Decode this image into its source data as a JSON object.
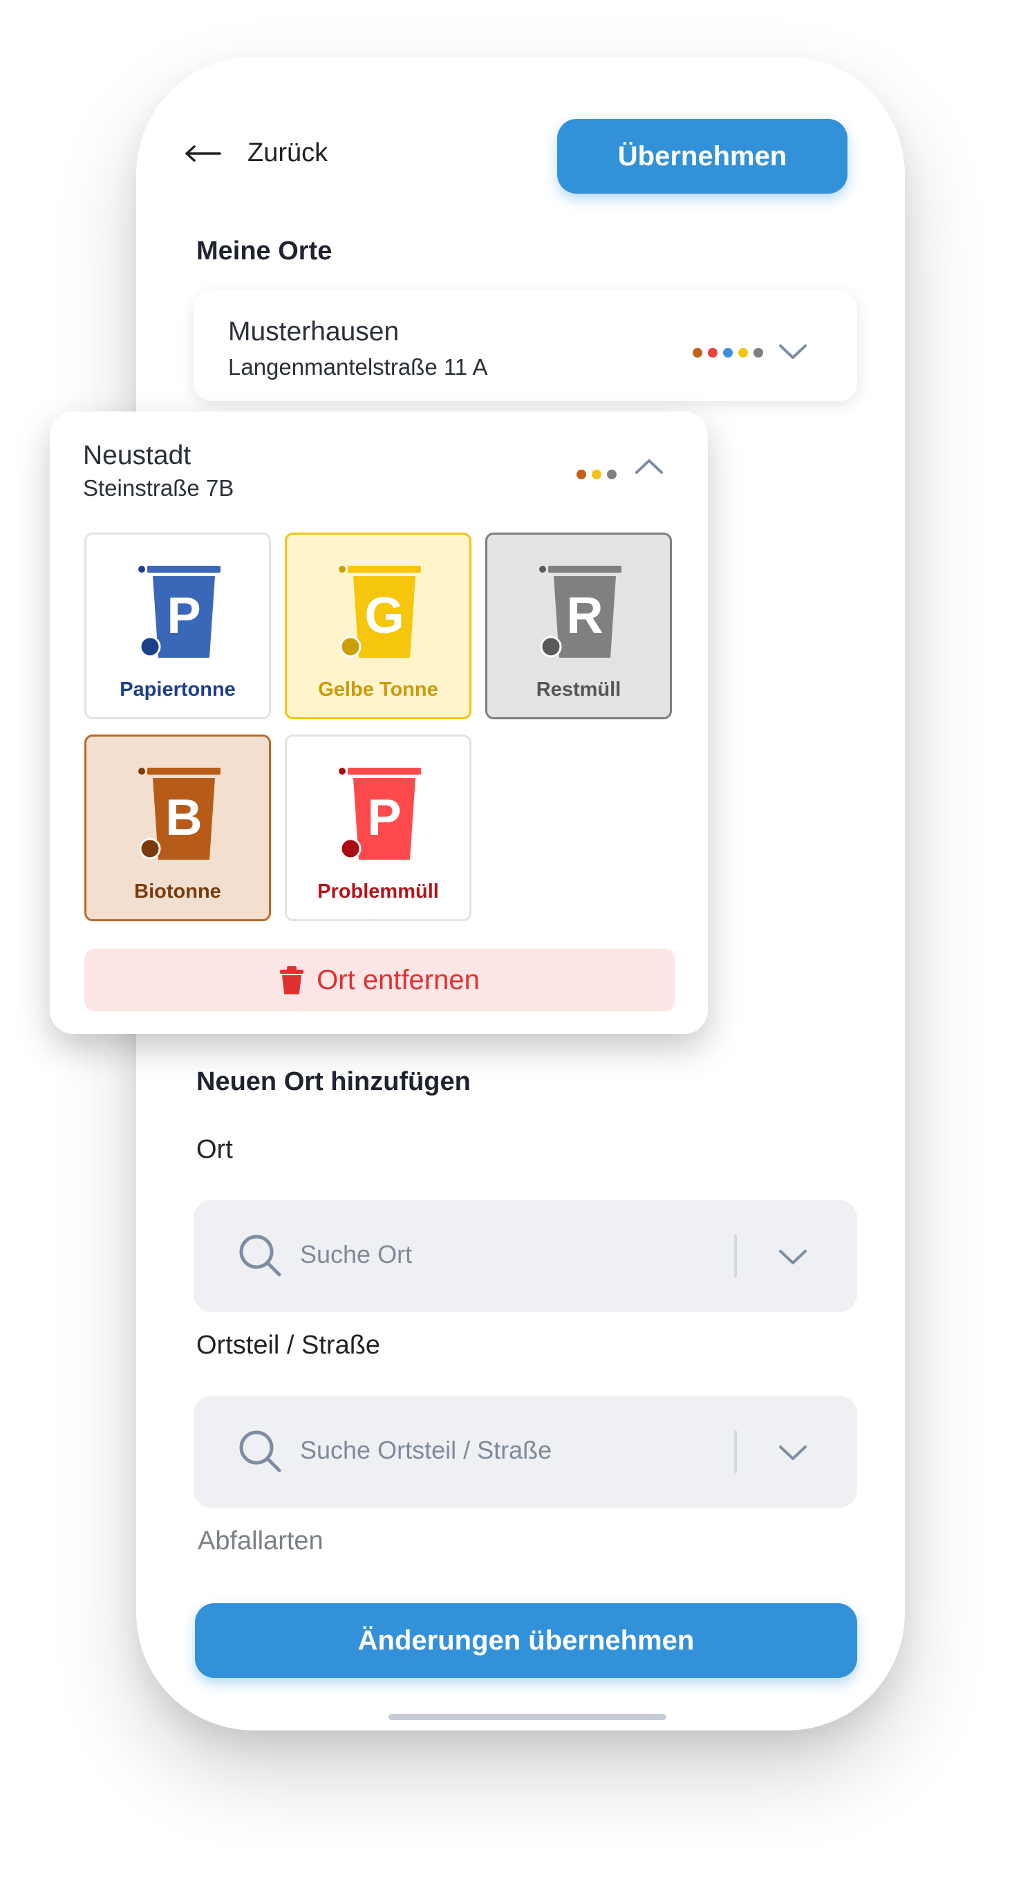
{
  "header": {
    "back_label": "Zurück",
    "apply_label": "Übernehmen"
  },
  "my_places": {
    "title": "Meine Orte",
    "places": [
      {
        "name": "Musterhausen",
        "street": "Langenmantelstraße 11 A",
        "dots": [
          "#c0601b",
          "#e8423f",
          "#3d8fe0",
          "#f3c417",
          "#808080"
        ]
      },
      {
        "name": "Neustadt",
        "street": "Steinstraße 7B",
        "dots": [
          "#c0601b",
          "#f3c417",
          "#808080"
        ]
      }
    ]
  },
  "bins": [
    {
      "letter": "P",
      "label": "Papiertonne",
      "bin_color": "#3a67b7",
      "wheel_color": "#1d3f8a",
      "label_color": "#1d3f8a",
      "bg": "#ffffff",
      "border": "#e3e3e3"
    },
    {
      "letter": "G",
      "label": "Gelbe Tonne",
      "bin_color": "#f6c60c",
      "wheel_color": "#c9a00a",
      "label_color": "#c99a0b",
      "bg": "#fff4cc",
      "border": "#f1c40f"
    },
    {
      "letter": "R",
      "label": "Restmüll",
      "bin_color": "#808080",
      "wheel_color": "#5a5a5a",
      "label_color": "#555555",
      "bg": "#e3e3e3",
      "border": "#7d7d7d"
    },
    {
      "letter": "B",
      "label": "Biotonne",
      "bin_color": "#b65c18",
      "wheel_color": "#7a3b0c",
      "label_color": "#7a3b0c",
      "bg": "#f2dfcf",
      "border": "#b86a2c"
    },
    {
      "letter": "P",
      "label": "Problemmüll",
      "bin_color": "#ff4a4d",
      "wheel_color": "#a80d12",
      "label_color": "#b3141a",
      "bg": "#ffffff",
      "border": "#e3e3e3"
    }
  ],
  "remove_label": "Ort entfernen",
  "new_place": {
    "title": "Neuen Ort hinzufügen",
    "ort_label": "Ort",
    "ort_placeholder": "Suche Ort",
    "street_label": "Ortsteil / Straße",
    "street_placeholder": "Suche Ortsteil / Straße",
    "waste_types_label": "Abfallarten"
  },
  "apply_changes_label": "Änderungen übernehmen"
}
